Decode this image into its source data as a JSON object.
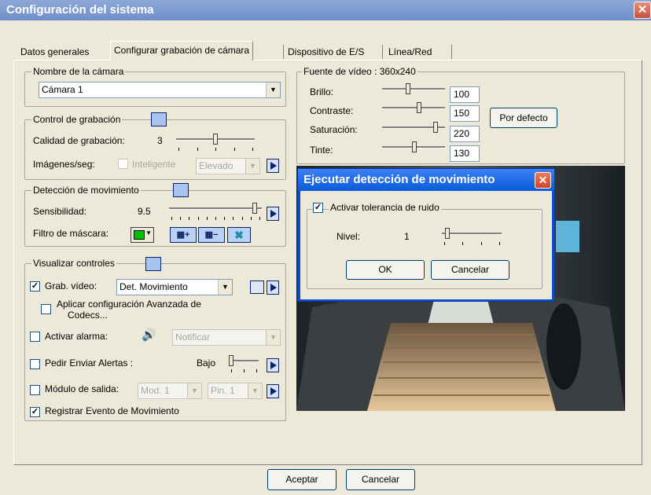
{
  "window": {
    "title": "Configuración del sistema",
    "close_glyph": "✕"
  },
  "tabs": [
    {
      "label": "Datos generales"
    },
    {
      "label": "Configurar grabación de cámara"
    },
    {
      "label": "Dispositivo de E/S"
    },
    {
      "label": "Línea/Red"
    }
  ],
  "camera_name": {
    "group_label": "Nombre de la cámara",
    "selected": "Cámara 1"
  },
  "recording_control": {
    "group_label": "Control de grabación",
    "quality_label": "Calidad de grabación:",
    "quality_value": "3",
    "quality_level": 0.5,
    "fps_label": "Imágenes/seg:",
    "smart_label": "Inteligente",
    "fps_selected": "Elevado"
  },
  "motion_detection": {
    "group_label": "Detección de movimiento",
    "sensitivity_label": "Sensibilidad:",
    "sensitivity_value": "9.5",
    "sensitivity_level": 0.95,
    "mask_filter_label": "Filtro de máscara:",
    "mask_color": "#00c000"
  },
  "display_controls": {
    "group_label": "Visualizar controles",
    "video_record_label": "Grab. vídeo:",
    "video_record_checked": true,
    "video_record_mode": "Det. Movimiento",
    "advanced_codecs_label_1": "Aplicar configuración Avanzada de",
    "advanced_codecs_label_2": "Codecs...",
    "alarm_label": "Activar alarma:",
    "alarm_selected": "Notificar",
    "alerts_label": "Pedir Enviar Alertas :",
    "alerts_value": "Bajo",
    "output_label": "Módulo de salida:",
    "output_module": "Mod. 1",
    "output_pin": "Pin. 1",
    "register_event_label": "Registrar Evento de Movimiento",
    "register_event_checked": true
  },
  "video_source": {
    "group_label": "Fuente de vídeo : 360x240",
    "rows": [
      {
        "label": "Brillo:",
        "value": "100",
        "level": 0.4
      },
      {
        "label": "Contraste:",
        "value": "150",
        "level": 0.6
      },
      {
        "label": "Saturación:",
        "value": "220",
        "level": 0.88
      },
      {
        "label": "Tinte:",
        "value": "130",
        "level": 0.52
      }
    ],
    "default_button": "Por defecto"
  },
  "dialog": {
    "title": "Ejecutar detección de movimiento",
    "noise_label": "Activar tolerancia de ruido",
    "noise_checked": true,
    "level_label": "Nivel:",
    "level_value": "1",
    "level_fraction": 0.05,
    "ok": "OK",
    "cancel": "Cancelar"
  },
  "footer": {
    "accept": "Aceptar",
    "cancel": "Cancelar"
  }
}
